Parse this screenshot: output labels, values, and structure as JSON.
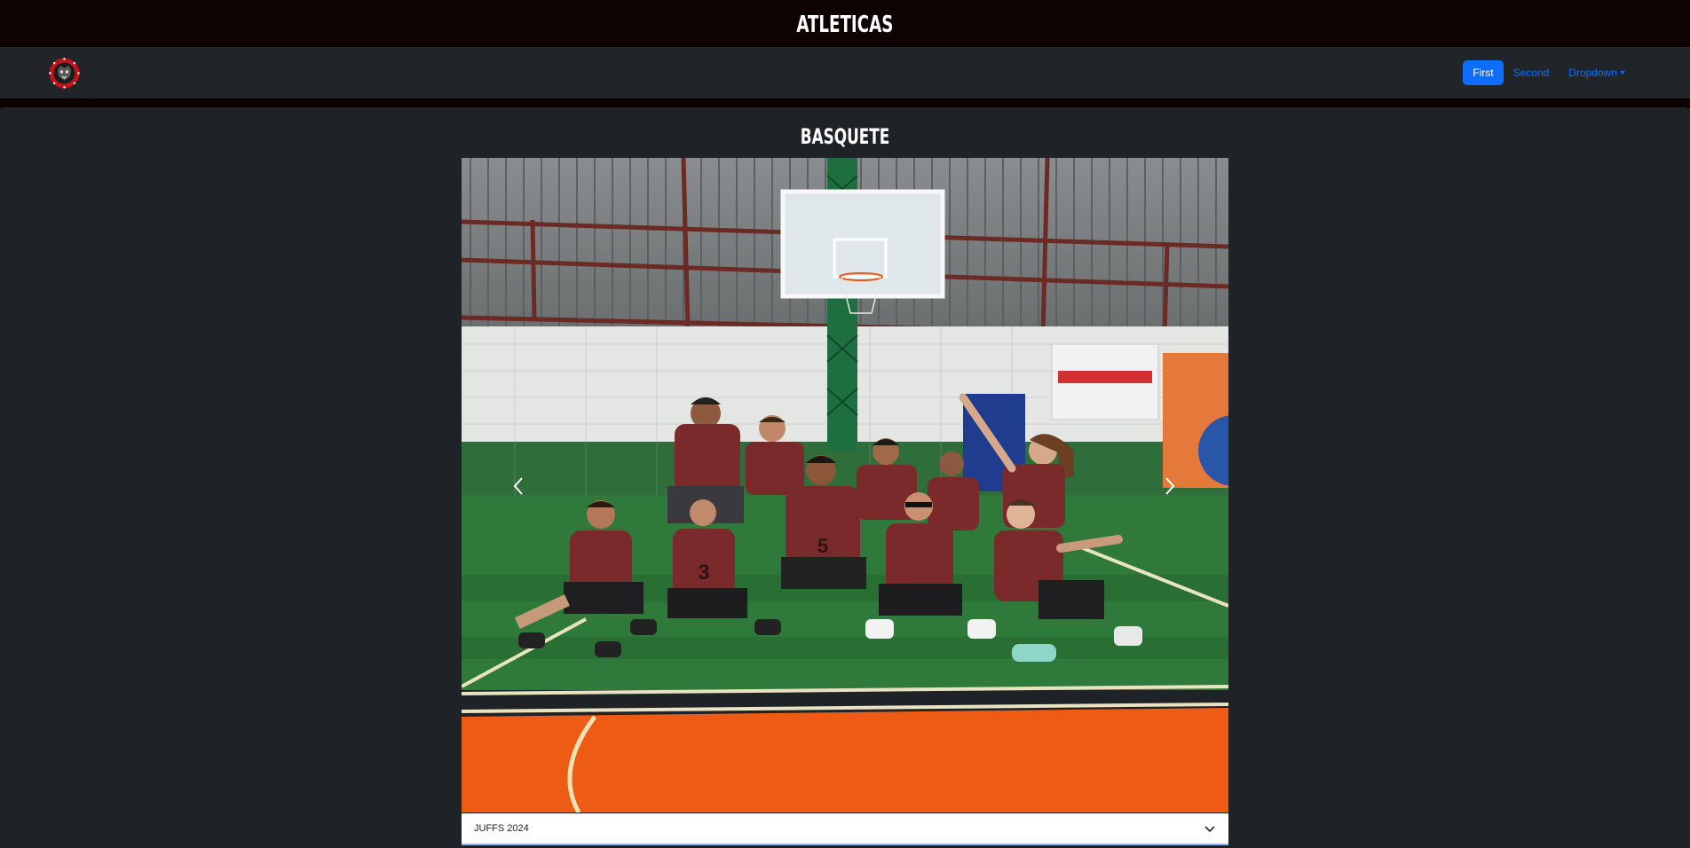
{
  "header": {
    "site_title": "ATLETICAS"
  },
  "navbar": {
    "logo_icon": "athletic-logo-icon",
    "links": [
      {
        "label": "First",
        "active": true
      },
      {
        "label": "Second",
        "active": false
      },
      {
        "label": "Dropdown",
        "active": false,
        "has_caret": true
      }
    ]
  },
  "main": {
    "section_title": "BASQUETE",
    "carousel": {
      "image_subject": "basketball team photo on court",
      "prev_icon": "chevron-left-icon",
      "next_icon": "chevron-right-icon"
    },
    "event_select": {
      "selected": "JUFFS 2024",
      "icon": "chevron-down-icon"
    }
  },
  "colors": {
    "topbar": "#0f0203",
    "navbar": "#212529",
    "page_bg": "#1f2227",
    "link": "#0d6efd",
    "jersey": "#7a2a2a",
    "court_green": "#2f7a3a",
    "court_orange": "#ef5f14"
  }
}
